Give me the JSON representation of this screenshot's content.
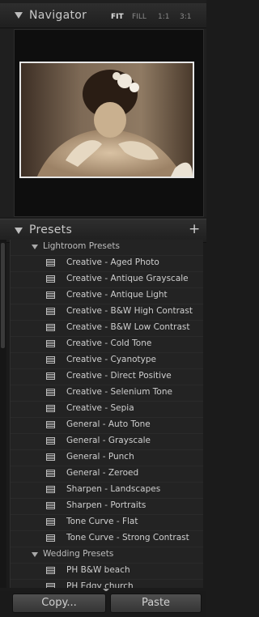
{
  "navigator": {
    "title": "Navigator",
    "zoom": [
      "FIT",
      "FILL",
      "1:1",
      "3:1"
    ],
    "active_zoom": "FIT"
  },
  "presets": {
    "title": "Presets",
    "add_label": "+",
    "folders": [
      {
        "name": "Lightroom Presets",
        "items": [
          "Creative - Aged Photo",
          "Creative - Antique Grayscale",
          "Creative - Antique Light",
          "Creative - B&W High Contrast",
          "Creative - B&W Low Contrast",
          "Creative - Cold Tone",
          "Creative - Cyanotype",
          "Creative - Direct Positive",
          "Creative - Selenium Tone",
          "Creative - Sepia",
          "General - Auto Tone",
          "General - Grayscale",
          "General - Punch",
          "General - Zeroed",
          "Sharpen - Landscapes",
          "Sharpen - Portraits",
          "Tone Curve - Flat",
          "Tone Curve - Strong Contrast"
        ]
      },
      {
        "name": "Wedding Presets",
        "items": [
          "PH B&W beach",
          "PH Edgy church"
        ]
      }
    ]
  },
  "buttons": {
    "copy": "Copy...",
    "paste": "Paste"
  }
}
